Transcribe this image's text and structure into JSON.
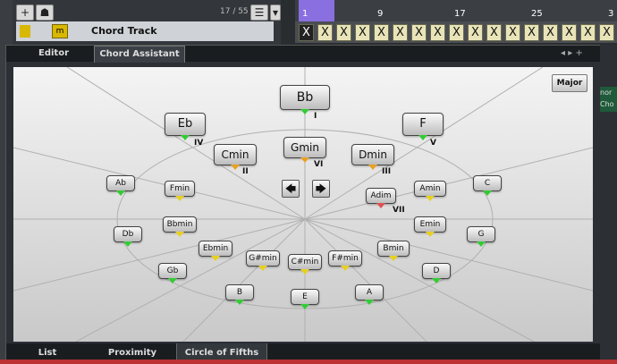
{
  "track": {
    "add_label": "+",
    "counter": "17 / 55",
    "title": "Chord Track",
    "icon_label": "m"
  },
  "ruler": {
    "marks": [
      "1",
      "9",
      "17",
      "25",
      "3"
    ]
  },
  "chord_lane": {
    "events": [
      "X",
      "X",
      "X",
      "X",
      "X",
      "X",
      "X",
      "X",
      "X",
      "X",
      "X",
      "X",
      "X",
      "X",
      "X",
      "X",
      "X",
      "X"
    ]
  },
  "panel": {
    "tabs": [
      "Editor",
      "Chord Assistant"
    ],
    "bottom_tabs": [
      "List",
      "Proximity",
      "Circle of Fifths"
    ],
    "mode_button": "Major",
    "nav_glyphs": [
      "◂",
      "▸",
      "+"
    ]
  },
  "right_side": {
    "text": "nor Cho"
  },
  "colors": {
    "green": "#33cc33",
    "orange": "#e8a020",
    "yellow": "#e8d020",
    "red": "#e05050"
  },
  "chords_large": [
    {
      "label": "Bb",
      "roman": "I",
      "color": "green"
    },
    {
      "label": "Eb",
      "roman": "IV",
      "color": "green"
    },
    {
      "label": "F",
      "roman": "V",
      "color": "green"
    },
    {
      "label": "Cmin",
      "roman": "II",
      "color": "orange"
    },
    {
      "label": "Gmin",
      "roman": "VI",
      "color": "orange"
    },
    {
      "label": "Dmin",
      "roman": "III",
      "color": "orange"
    }
  ],
  "chords_small": [
    {
      "label": "Ab",
      "color": "green"
    },
    {
      "label": "Fmin",
      "color": "yellow"
    },
    {
      "label": "Adim",
      "roman": "VII",
      "color": "red"
    },
    {
      "label": "Amin",
      "color": "yellow"
    },
    {
      "label": "C",
      "color": "green"
    },
    {
      "label": "Db",
      "color": "green"
    },
    {
      "label": "Bbmin",
      "color": "yellow"
    },
    {
      "label": "Emin",
      "color": "yellow"
    },
    {
      "label": "G",
      "color": "green"
    },
    {
      "label": "Ebmin",
      "color": "yellow"
    },
    {
      "label": "G#min",
      "color": "yellow"
    },
    {
      "label": "C#min",
      "color": "yellow"
    },
    {
      "label": "F#min",
      "color": "yellow"
    },
    {
      "label": "Bmin",
      "color": "yellow"
    },
    {
      "label": "Gb",
      "color": "green"
    },
    {
      "label": "D",
      "color": "green"
    },
    {
      "label": "B",
      "color": "green"
    },
    {
      "label": "E",
      "color": "green"
    },
    {
      "label": "A",
      "color": "green"
    }
  ],
  "arrows": [
    "left-arrow",
    "right-arrow"
  ]
}
